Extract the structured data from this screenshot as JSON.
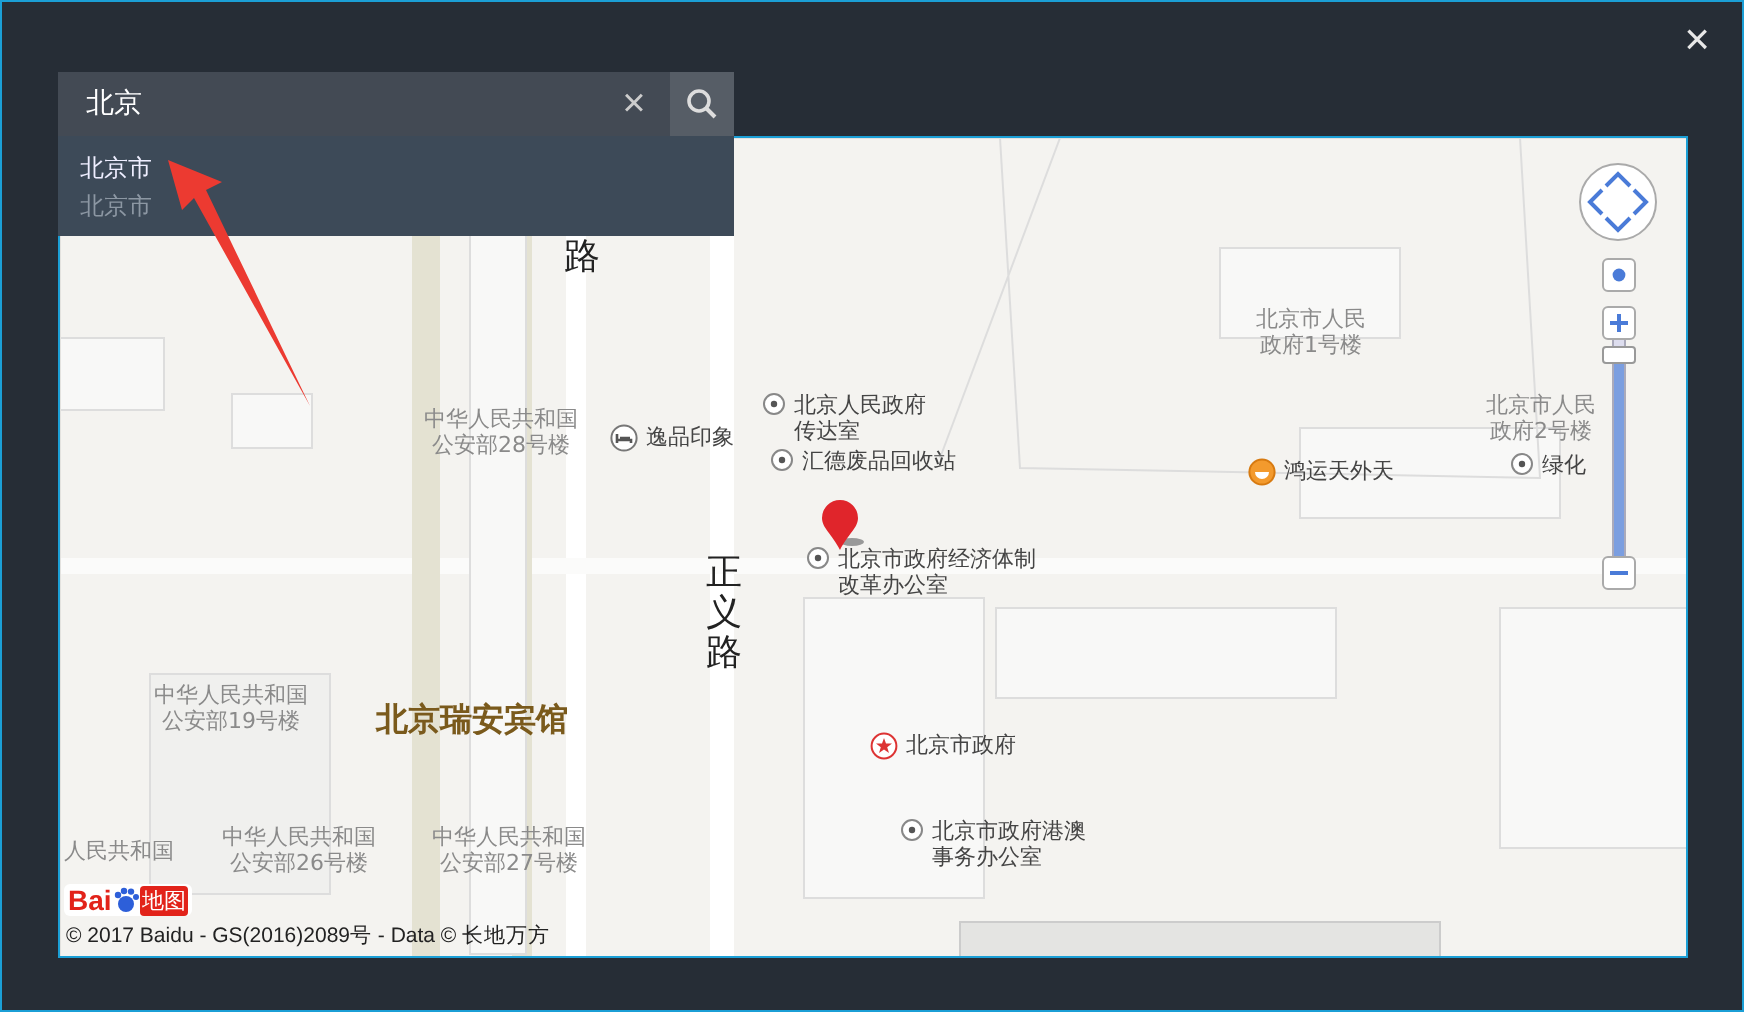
{
  "window": {
    "close": "×"
  },
  "search": {
    "value": "北京",
    "clear": "×"
  },
  "suggestions": [
    {
      "title": "北京市",
      "subtitle": "北京市"
    }
  ],
  "map": {
    "labels": [
      {
        "kind": "road",
        "lines": [
          "路"
        ]
      },
      {
        "kind": "building",
        "lines": [
          "中华人民共和国",
          "公安部28号楼"
        ]
      },
      {
        "kind": "hotel",
        "lines": [
          "逸品印象"
        ]
      },
      {
        "kind": "poi",
        "lines": [
          "北京人民政府",
          "传达室"
        ]
      },
      {
        "kind": "poi",
        "lines": [
          "汇德废品回收站"
        ]
      },
      {
        "kind": "road",
        "lines": [
          "正义路"
        ]
      },
      {
        "kind": "poi",
        "lines": [
          "北京市政府经济体制",
          "改革办公室"
        ]
      },
      {
        "kind": "building",
        "lines": [
          "北京市人民",
          "政府1号楼"
        ]
      },
      {
        "kind": "building",
        "lines": [
          "北京市人民",
          "政府2号楼"
        ]
      },
      {
        "kind": "food",
        "lines": [
          "鸿运天外天"
        ]
      },
      {
        "kind": "poi",
        "lines": [
          "绿化"
        ]
      },
      {
        "kind": "building",
        "lines": [
          "中华人民共和国",
          "公安部19号楼"
        ]
      },
      {
        "kind": "landmark",
        "lines": [
          "北京瑞安宾馆"
        ]
      },
      {
        "kind": "gov",
        "lines": [
          "北京市政府"
        ]
      },
      {
        "kind": "building",
        "lines": [
          "人民共和国"
        ]
      },
      {
        "kind": "building",
        "lines": [
          "中华人民共和国",
          "公安部26号楼"
        ]
      },
      {
        "kind": "building",
        "lines": [
          "中华人民共和国",
          "公安部27号楼"
        ]
      },
      {
        "kind": "poi",
        "lines": [
          "北京市政府港澳",
          "事务办公室"
        ]
      }
    ],
    "zoom": {
      "level": 0.97
    },
    "logo": {
      "left": "Bai",
      "right": "地图"
    },
    "copyright": "© 2017 Baidu - GS(2016)2089号 - Data © 长地万方"
  }
}
